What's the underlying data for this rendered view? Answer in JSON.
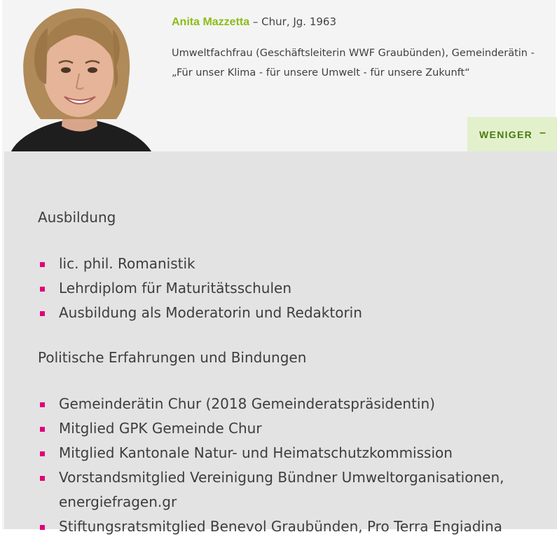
{
  "person": {
    "name": "Anita Mazzetta",
    "meta": " – Chur, Jg. 1963",
    "description": "Umweltfachfrau (Geschäftsleiterin WWF Graubünden), Gemeinderätin - „Für unser Klima - für unsere Umwelt - für unsere Zukunft“"
  },
  "toggle": {
    "label": "WENIGER",
    "symbol": "–"
  },
  "sections": [
    {
      "title": "Ausbildung",
      "items": [
        "lic. phil. Romanistik",
        "Lehrdiplom für Maturitätsschulen",
        "Ausbildung als Moderatorin und Redaktorin"
      ]
    },
    {
      "title": "Politische Erfahrungen und Bindungen",
      "items": [
        "Gemeinderätin Chur (2018 Gemeinderatspräsidentin)",
        "Mitglied GPK Gemeinde Chur",
        "Mitglied Kantonale Natur- und Heimatschutzkommission",
        "Vorstandsmitglied Vereinigung Bündner Umweltorganisationen, energiefragen.gr",
        "Stiftungsratsmitglied Benevol Graubünden, Pro Terra Engiadina"
      ]
    }
  ],
  "colors": {
    "name": "#8cbd18",
    "accent_button": "#e3f0cc",
    "bullet": "#e0007a",
    "panel": "#e3e3e3"
  }
}
